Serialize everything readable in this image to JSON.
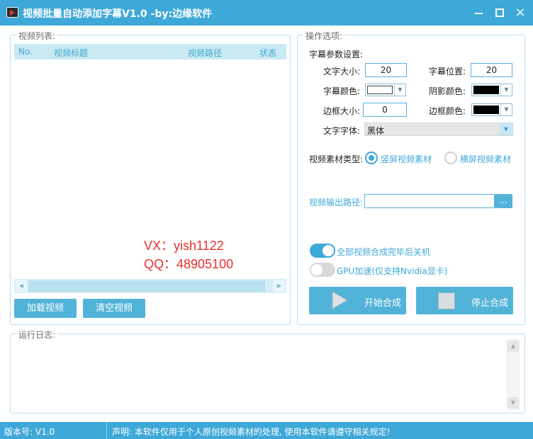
{
  "window": {
    "title": "视频批量自动添加字幕V1.0 -by:边缘软件",
    "close_glyph": "×"
  },
  "video_list": {
    "legend": "视频列表:",
    "columns": [
      "No.",
      "视频标题",
      "视频路径",
      "状态"
    ],
    "rows": [],
    "watermark_vx": "VX：yish1122",
    "watermark_qq": "QQ：48905100",
    "load_button": "加载视频",
    "clear_button": "清空视频"
  },
  "options": {
    "legend": "操作选项:",
    "subtitle_params_label": "字幕参数设置:",
    "font_size_label": "文字大小:",
    "font_size_value": "20",
    "subtitle_pos_label": "字幕位置:",
    "subtitle_pos_value": "20",
    "subtitle_color_label": "字幕颜色:",
    "subtitle_color": "#ffffff",
    "shadow_color_label": "阴影颜色:",
    "shadow_color": "#000000",
    "border_size_label": "边框大小:",
    "border_size_value": "0",
    "border_color_label": "边框颜色:",
    "border_color": "#000000",
    "font_family_label": "文字字体:",
    "font_family_value": "黑体",
    "material_type_label": "视频素材类型:",
    "material_vertical": "竖屏视频素材",
    "material_horizontal": "横屏视频素材",
    "material_selected": "竖屏视频素材",
    "output_path_label": "视频输出路径:",
    "output_path_value": "",
    "browse_button": "...",
    "shutdown_toggle_label": "全部视频合成完毕后关机",
    "shutdown_toggle_on": true,
    "gpu_toggle_label": "GPU加速(仅支持Nvidia显卡)",
    "gpu_toggle_on": false,
    "start_button": "开始合成",
    "stop_button": "停止合成"
  },
  "log": {
    "legend": "运行日志:",
    "content": ""
  },
  "status": {
    "version": "版本号: V1.0",
    "notice": "声明: 本软件仅用于个人原创视频素材的处理, 使用本软件请遵守相关规定!"
  },
  "colors": {
    "accent": "#3ea8d9",
    "button": "#52b3d9",
    "header_bg": "#c9eaf2",
    "watermark": "#e8302c"
  }
}
